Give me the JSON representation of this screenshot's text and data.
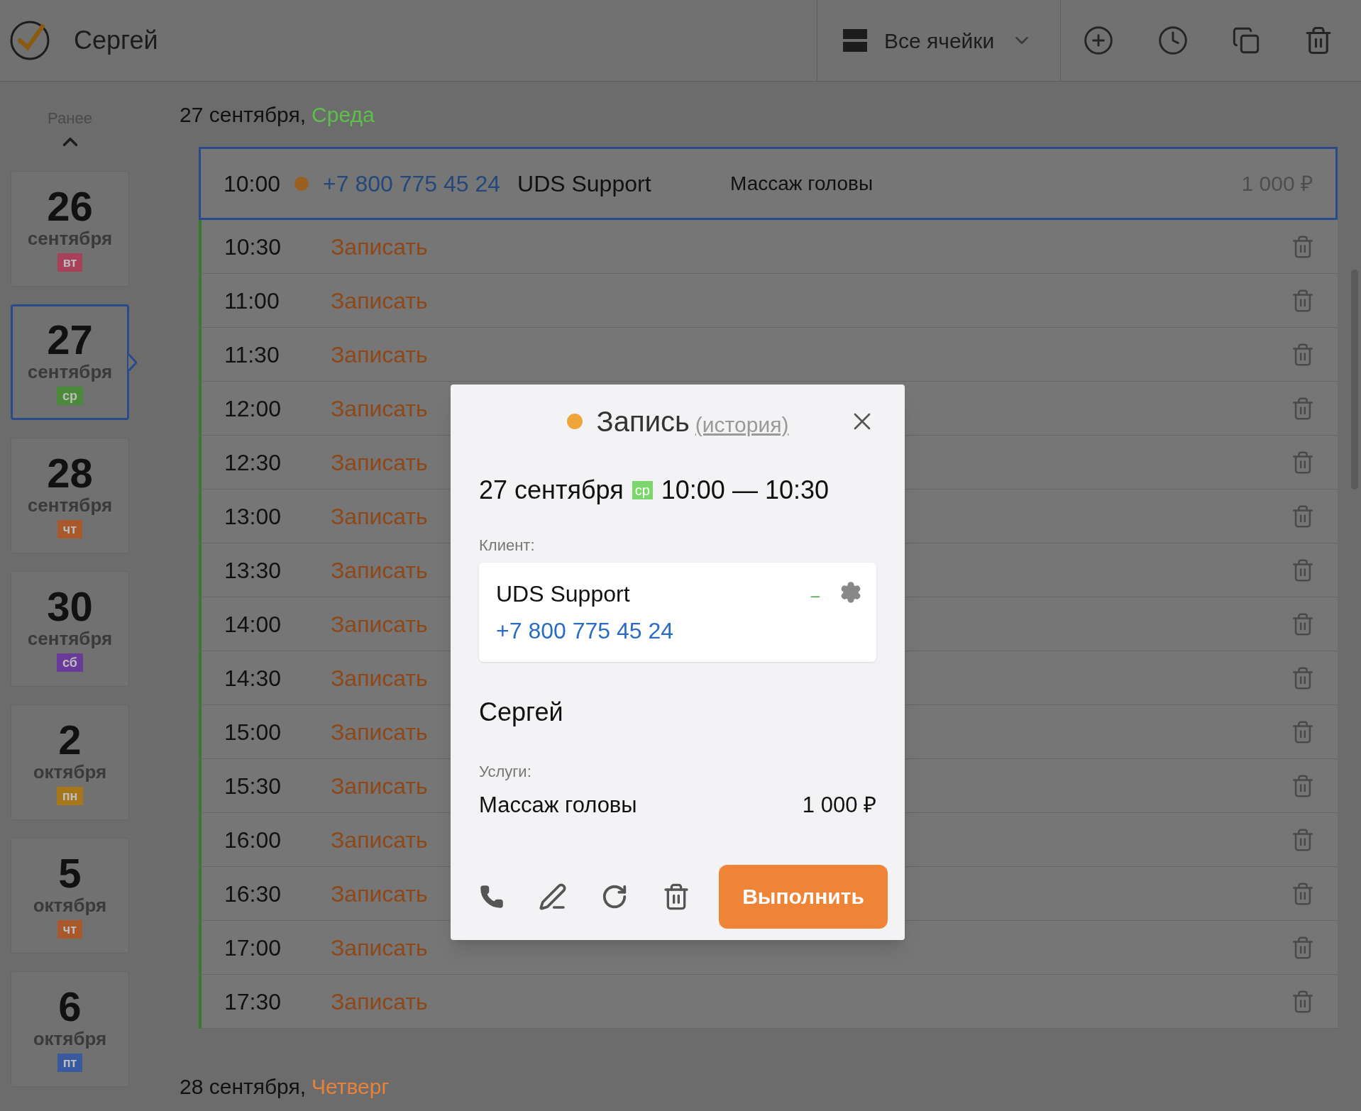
{
  "header": {
    "title": "Сергей",
    "filter": "Все ячейки"
  },
  "sidebar": {
    "earlier": "Ранее",
    "days": [
      {
        "day": "26",
        "month": "сентября",
        "weekday": "вт",
        "color": "#a8405a",
        "selected": false
      },
      {
        "day": "27",
        "month": "сентября",
        "weekday": "ср",
        "color": "#4a8a3a",
        "selected": true
      },
      {
        "day": "28",
        "month": "сентября",
        "weekday": "чт",
        "color": "#a8582a",
        "selected": false
      },
      {
        "day": "30",
        "month": "сентября",
        "weekday": "сб",
        "color": "#6a3a9a",
        "selected": false
      },
      {
        "day": "2",
        "month": "октября",
        "weekday": "пн",
        "color": "#a8761a",
        "selected": false
      },
      {
        "day": "5",
        "month": "октября",
        "weekday": "чт",
        "color": "#a8582a",
        "selected": false
      },
      {
        "day": "6",
        "month": "октября",
        "weekday": "пт",
        "color": "#3a5aa0",
        "selected": false
      }
    ]
  },
  "sections": [
    {
      "date": "27 сентября,",
      "weekday": "Среда",
      "color": "#5cc04a",
      "rows": [
        {
          "kind": "booking",
          "time": "10:00",
          "color": "#9a6020",
          "phone": "+7 800 775 45 24",
          "client": "UDS Support",
          "service": "Массаж головы",
          "price": "1 000 ₽"
        },
        {
          "kind": "free",
          "time": "10:30",
          "action": "Записать"
        },
        {
          "kind": "free",
          "time": "11:00",
          "action": "Записать"
        },
        {
          "kind": "free",
          "time": "11:30",
          "action": "Записать"
        },
        {
          "kind": "free",
          "time": "12:00",
          "action": "Записать"
        },
        {
          "kind": "free",
          "time": "12:30",
          "action": "Записать"
        },
        {
          "kind": "free",
          "time": "13:00",
          "action": "Записать"
        },
        {
          "kind": "free",
          "time": "13:30",
          "action": "Записать"
        },
        {
          "kind": "free",
          "time": "14:00",
          "action": "Записать"
        },
        {
          "kind": "free",
          "time": "14:30",
          "action": "Записать"
        },
        {
          "kind": "free",
          "time": "15:00",
          "action": "Записать"
        },
        {
          "kind": "free",
          "time": "15:30",
          "action": "Записать"
        },
        {
          "kind": "free",
          "time": "16:00",
          "action": "Записать"
        },
        {
          "kind": "free",
          "time": "16:30",
          "action": "Записать"
        },
        {
          "kind": "free",
          "time": "17:00",
          "action": "Записать"
        },
        {
          "kind": "free",
          "time": "17:30",
          "action": "Записать"
        }
      ]
    },
    {
      "date": "28 сентября,",
      "weekday": "Четверг",
      "color": "#e8823a"
    }
  ],
  "modal": {
    "title": "Запись",
    "history_link": "(история)",
    "status": {
      "color": "#eea63a"
    },
    "date": "27 сентября",
    "weekday": {
      "label": "ср",
      "color": "#7bd66b"
    },
    "time": "10:00 — 10:30",
    "client_label": "Клиент:",
    "client": {
      "name": "UDS Support",
      "phone": "+7 800 775 45 24",
      "balance": "–"
    },
    "master": "Сергей",
    "services_label": "Услуги:",
    "services": [
      {
        "name": "Массаж головы",
        "price": "1 000 ₽"
      }
    ],
    "submit": "Выполнить"
  }
}
